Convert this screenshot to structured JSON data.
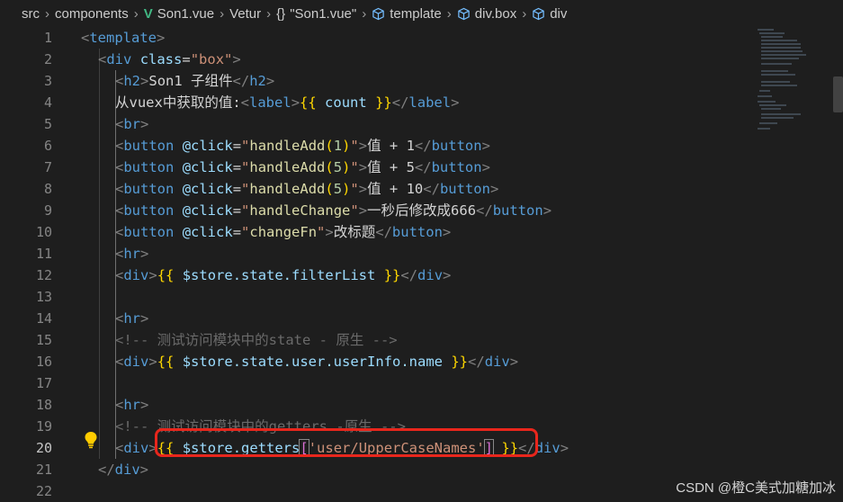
{
  "breadcrumb": {
    "items": [
      "src",
      "components",
      "Son1.vue",
      "Vetur",
      "\"Son1.vue\"",
      "template",
      "div.box",
      "div"
    ],
    "braces": "{}"
  },
  "editor": {
    "active_line": 20,
    "lines": [
      {
        "n": "1"
      },
      {
        "n": "2"
      },
      {
        "n": "3"
      },
      {
        "n": "4"
      },
      {
        "n": "5"
      },
      {
        "n": "6"
      },
      {
        "n": "7"
      },
      {
        "n": "8"
      },
      {
        "n": "9"
      },
      {
        "n": "10"
      },
      {
        "n": "11"
      },
      {
        "n": "12"
      },
      {
        "n": "13"
      },
      {
        "n": "14"
      },
      {
        "n": "15"
      },
      {
        "n": "16"
      },
      {
        "n": "17"
      },
      {
        "n": "18"
      },
      {
        "n": "19"
      },
      {
        "n": "20"
      },
      {
        "n": "21"
      },
      {
        "n": "22"
      }
    ],
    "code": {
      "l1_tag": "template",
      "l2_tag": "div",
      "l2_attr": "class",
      "l2_val": "\"box\"",
      "l3_tag": "h2",
      "l3_text": "Son1 子组件",
      "l4_text": "从vuex中获取的值:",
      "l4_tag": "label",
      "l4_expr": "count",
      "l5_tag": "br",
      "l6_attr": "@click",
      "l6_fn": "handleAdd",
      "l6_arg": "1",
      "l6_text": "值 + 1",
      "l7_attr": "@click",
      "l7_fn": "handleAdd",
      "l7_arg": "5",
      "l7_text": "值 + 5",
      "l8_attr": "@click",
      "l8_fn": "handleAdd",
      "l8_arg": "5",
      "l8_text": "值 + 10",
      "l9_attr": "@click",
      "l9_fn": "handleChange",
      "l9_text": "一秒后修改成666",
      "l10_attr": "@click",
      "l10_fn": "changeFn",
      "l10_text": "改标题",
      "btn_tag": "button",
      "hr_tag": "hr",
      "div_tag": "div",
      "l12_expr": "$store.state.filterList",
      "l15_comment": "<!-- 测试访问模块中的state - 原生 -->",
      "l16_expr": "$store.state.user.userInfo.name",
      "l19_comment": "<!-- 测试访问模块中的getters -原生 -->",
      "l20_obj": "$store.getters",
      "l20_key": "'user/UpperCaseNames'",
      "l21_tag": "div"
    }
  },
  "watermark": "CSDN @橙C美式加糖加冰",
  "colors": {
    "background": "#1e1e1e",
    "highlight_box": "#e8261c",
    "vue_green": "#41b883"
  }
}
